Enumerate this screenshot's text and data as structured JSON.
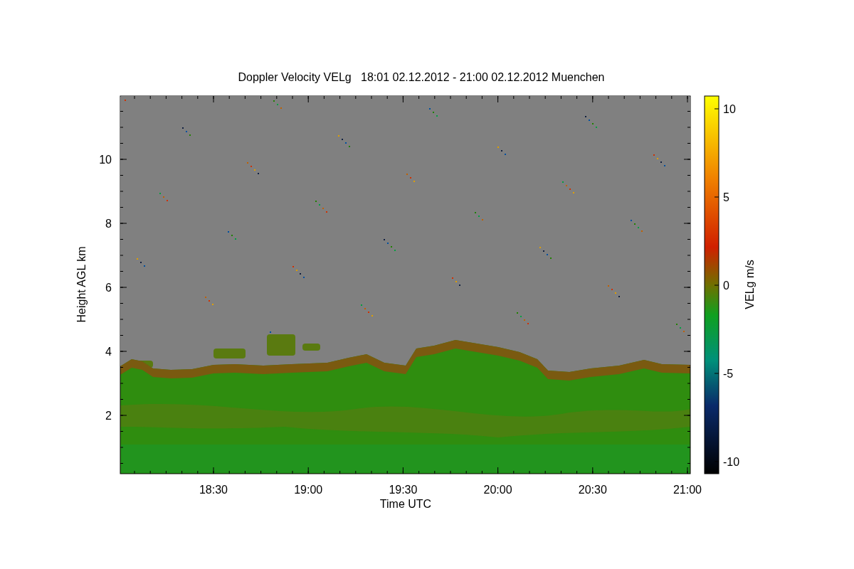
{
  "title": "Doppler Velocity VELg   18:01 02.12.2012 - 21:00 02.12.2012 Muenchen",
  "x_axis": {
    "label": "Time UTC",
    "ticks": [
      "18:30",
      "19:00",
      "19:30",
      "20:00",
      "20:30",
      "21:00"
    ]
  },
  "y_axis": {
    "label": "Height AGL km",
    "ticks": [
      "10",
      "8",
      "6",
      "4",
      "2"
    ]
  },
  "colorbar": {
    "label": "VELg m/s",
    "ticks": [
      "10",
      "5",
      "0",
      "-5",
      "-10"
    ]
  }
}
